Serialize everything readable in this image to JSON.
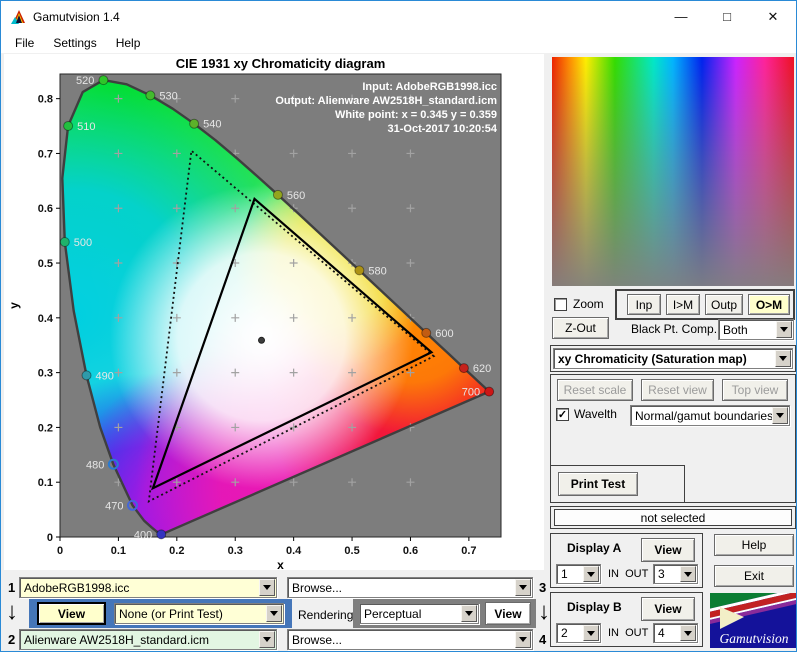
{
  "window": {
    "title": "Gamutvision 1.4",
    "menu": [
      "File",
      "Settings",
      "Help"
    ]
  },
  "icons": {
    "minimize": "—",
    "maximize": "□",
    "close": "✕",
    "check": "✓",
    "down_arrow": "↓"
  },
  "chart": {
    "title": "CIE 1931 xy Chromaticity diagram",
    "xlabel": "x",
    "ylabel": "y",
    "annotations": [
      "Input:  AdobeRGB1998.icc",
      "Output: Alienware AW2518H_standard.icm",
      "White point:  x = 0.345  y = 0.359",
      "31-Oct-2017 10:20:54"
    ]
  },
  "chart_data": {
    "type": "chromaticity-diagram",
    "xlim": [
      0,
      0.755
    ],
    "ylim": [
      0,
      0.845
    ],
    "x_ticks": [
      "0",
      "0.1",
      "0.2",
      "0.3",
      "0.4",
      "0.5",
      "0.6",
      "0.7"
    ],
    "y_ticks": [
      "0",
      "0.1",
      "0.2",
      "0.3",
      "0.4",
      "0.5",
      "0.6",
      "0.7",
      "0.8"
    ],
    "grid_marks": {
      "x": [
        0.1,
        0.2,
        0.3,
        0.4,
        0.5,
        0.6
      ],
      "y": [
        0.1,
        0.2,
        0.3,
        0.4,
        0.5,
        0.6,
        0.7,
        0.8
      ]
    },
    "spectral_locus": [
      [
        380,
        0.1741,
        0.005
      ],
      [
        400,
        0.1733,
        0.0048
      ],
      [
        420,
        0.1714,
        0.0051
      ],
      [
        440,
        0.1644,
        0.0109
      ],
      [
        450,
        0.1566,
        0.0177
      ],
      [
        460,
        0.144,
        0.0297
      ],
      [
        470,
        0.1241,
        0.0578
      ],
      [
        480,
        0.0913,
        0.1327
      ],
      [
        485,
        0.0687,
        0.2007
      ],
      [
        490,
        0.0454,
        0.295
      ],
      [
        495,
        0.0235,
        0.4127
      ],
      [
        500,
        0.0082,
        0.5384
      ],
      [
        505,
        0.0039,
        0.6548
      ],
      [
        510,
        0.0139,
        0.7502
      ],
      [
        515,
        0.0389,
        0.812
      ],
      [
        520,
        0.0743,
        0.8338
      ],
      [
        525,
        0.1142,
        0.8262
      ],
      [
        530,
        0.1547,
        0.8059
      ],
      [
        535,
        0.1929,
        0.7816
      ],
      [
        540,
        0.2296,
        0.7543
      ],
      [
        545,
        0.2658,
        0.7243
      ],
      [
        550,
        0.3016,
        0.6923
      ],
      [
        555,
        0.3373,
        0.6589
      ],
      [
        560,
        0.3731,
        0.6245
      ],
      [
        565,
        0.4087,
        0.5896
      ],
      [
        570,
        0.4441,
        0.5547
      ],
      [
        575,
        0.4788,
        0.5202
      ],
      [
        580,
        0.5125,
        0.4866
      ],
      [
        585,
        0.5448,
        0.4544
      ],
      [
        590,
        0.5752,
        0.4242
      ],
      [
        595,
        0.6029,
        0.3965
      ],
      [
        600,
        0.627,
        0.3725
      ],
      [
        605,
        0.6482,
        0.3514
      ],
      [
        610,
        0.6658,
        0.334
      ],
      [
        620,
        0.6915,
        0.3083
      ],
      [
        630,
        0.7079,
        0.292
      ],
      [
        640,
        0.719,
        0.2809
      ],
      [
        650,
        0.726,
        0.274
      ],
      [
        680,
        0.7334,
        0.2666
      ],
      [
        700,
        0.7347,
        0.2653
      ]
    ],
    "wavelength_points": [
      {
        "nm": "400",
        "x": 0.1733,
        "y": 0.0048,
        "color": "#3333c0",
        "side": "left",
        "open": false
      },
      {
        "nm": "470",
        "x": 0.1241,
        "y": 0.0578,
        "color": "#4466d8",
        "side": "left",
        "open": true
      },
      {
        "nm": "480",
        "x": 0.0913,
        "y": 0.1327,
        "color": "#2b7ad0",
        "side": "left",
        "open": true
      },
      {
        "nm": "490",
        "x": 0.0454,
        "y": 0.295,
        "color": "#2f9aaa",
        "side": "right",
        "open": false
      },
      {
        "nm": "500",
        "x": 0.0082,
        "y": 0.5384,
        "color": "#1fb36b",
        "side": "right",
        "open": false
      },
      {
        "nm": "510",
        "x": 0.0139,
        "y": 0.7502,
        "color": "#22bf3f",
        "side": "right",
        "open": false
      },
      {
        "nm": "520",
        "x": 0.0743,
        "y": 0.8338,
        "color": "#2fc52a",
        "side": "left",
        "open": false
      },
      {
        "nm": "530",
        "x": 0.1547,
        "y": 0.8059,
        "color": "#43bb2e",
        "side": "right",
        "open": false
      },
      {
        "nm": "540",
        "x": 0.2296,
        "y": 0.7543,
        "color": "#5cb22a",
        "side": "right",
        "open": false
      },
      {
        "nm": "560",
        "x": 0.3731,
        "y": 0.6245,
        "color": "#93a51d",
        "side": "right",
        "open": false
      },
      {
        "nm": "580",
        "x": 0.5125,
        "y": 0.4866,
        "color": "#ad9214",
        "side": "right",
        "open": false
      },
      {
        "nm": "600",
        "x": 0.627,
        "y": 0.3725,
        "color": "#c25c12",
        "side": "right",
        "open": false
      },
      {
        "nm": "620",
        "x": 0.6915,
        "y": 0.3083,
        "color": "#c6221c",
        "side": "right",
        "open": false
      },
      {
        "nm": "700",
        "x": 0.7347,
        "y": 0.2653,
        "color": "#cc1616",
        "side": "left",
        "open": false
      }
    ],
    "input_gamut": {
      "name": "AdobeRGB1998.icc",
      "style": "dotted",
      "color": "#111111",
      "vertices": [
        [
          0.64,
          0.33
        ],
        [
          0.225,
          0.705
        ],
        [
          0.152,
          0.065
        ]
      ]
    },
    "output_gamut": {
      "name": "Alienware AW2518H_standard.icm",
      "style": "solid",
      "color": "#000000",
      "vertices": [
        [
          0.636,
          0.337
        ],
        [
          0.333,
          0.617
        ],
        [
          0.159,
          0.089
        ]
      ]
    },
    "white_point": {
      "x": 0.345,
      "y": 0.359,
      "color": "#3d3d3d"
    }
  },
  "right_panel": {
    "zoom_checkbox": {
      "label": "Zoom",
      "checked": false
    },
    "gamut_buttons": {
      "inp": "Inp",
      "im": "I>M",
      "outp": "Outp",
      "om": "O>M"
    },
    "zout_button": "Z-Out",
    "black_pt": {
      "label": "Black Pt. Comp.",
      "value": "Both"
    },
    "map_select": "xy Chromaticity (Saturation map)",
    "reset_buttons": {
      "scale": "Reset scale",
      "view": "Reset view",
      "top": "Top view"
    },
    "wavelth": {
      "label": "Wavelth",
      "checked": true
    },
    "boundaries_select": "Normal/gamut boundaries",
    "print_test": "Print Test",
    "status": "not selected",
    "display_a": {
      "title": "Display A",
      "view": "View",
      "in": "1",
      "inout_label": "IN  OUT",
      "out": "3"
    },
    "display_b": {
      "title": "Display B",
      "view": "View",
      "in": "2",
      "inout_label": "IN  OUT",
      "out": "4"
    },
    "help": "Help",
    "exit": "Exit",
    "logo_text": "Gamutvision"
  },
  "bottom": {
    "row1": {
      "num": "1",
      "file": "AdobeRGB1998.icc",
      "browse": "Browse...",
      "num_right": "3"
    },
    "mid": {
      "view_a": "View",
      "none_select": "None (or Print Test)",
      "rendering_label": "Rendering",
      "intent": "Perceptual",
      "view_b": "View"
    },
    "row2": {
      "num": "2",
      "file": "Alienware AW2518H_standard.icm",
      "browse": "Browse...",
      "num_right": "4"
    }
  },
  "colors": {
    "accent_yellow": "#ffffcc",
    "file1_bg": "#ffffd6",
    "file2_bg": "#e2f6e2",
    "blue_panel": "#4576b9",
    "gray_panel": "#7f7f7f",
    "plot_bg": "#7d7d7d",
    "titlebar_border": "#2a8ad6"
  }
}
